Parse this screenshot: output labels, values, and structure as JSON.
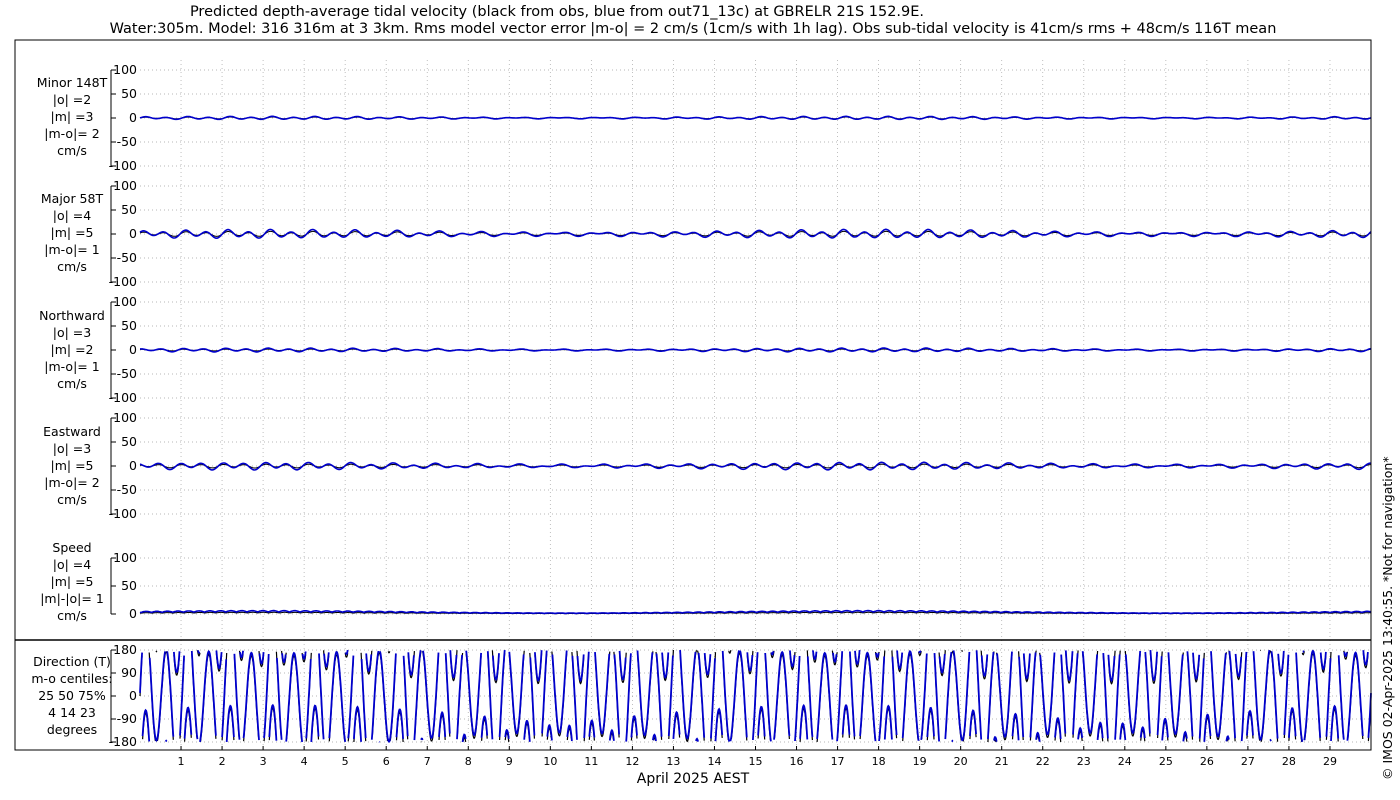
{
  "title_line1": "Predicted depth-average tidal velocity (black from obs, blue from out71_13c) at GBRELR 21S 152.9E.",
  "title_line2": "Water:305m. Model: 316 316m at 3 3km. Rms model vector error |m-o| = 2 cm/s (1cm/s with 1h lag). Obs sub-tidal velocity is 41cm/s rms + 48cm/s 116T mean",
  "credit": "© IMOS 02-Apr-2025 13:40:55. *Not for navigation*",
  "xlabel": "April 2025 AEST",
  "colors": {
    "obs": "#000000",
    "model": "#0000cc"
  },
  "chart_data": {
    "type": "line",
    "x_axis": {
      "label": "April 2025 AEST",
      "ticks": [
        1,
        2,
        3,
        4,
        5,
        6,
        7,
        8,
        9,
        10,
        11,
        12,
        13,
        14,
        15,
        16,
        17,
        18,
        19,
        20,
        21,
        22,
        23,
        24,
        25,
        26,
        27,
        28,
        29
      ],
      "range_days": [
        0,
        30.0
      ]
    },
    "panels": [
      {
        "id": "minor",
        "label_lines": [
          "Minor 148T",
          "|o| =2",
          "|m| =3",
          "|m-o|= 2",
          "cm/s"
        ],
        "yticks": [
          100,
          50,
          0,
          -50,
          -100
        ],
        "ylim": [
          -100,
          100
        ],
        "amplitude": [
          1.5,
          2.5
        ]
      },
      {
        "id": "major",
        "label_lines": [
          "Major 58T",
          "|o| =4",
          "|m| =5",
          "|m-o|= 1",
          "cm/s"
        ],
        "yticks": [
          100,
          50,
          0,
          -50,
          -100
        ],
        "ylim": [
          -100,
          100
        ],
        "amplitude": [
          4,
          7
        ]
      },
      {
        "id": "north",
        "label_lines": [
          "Northward",
          "|o| =3",
          "|m| =2",
          "|m-o|= 1",
          "cm/s"
        ],
        "yticks": [
          100,
          50,
          0,
          -50,
          -100
        ],
        "ylim": [
          -100,
          100
        ],
        "amplitude": [
          1.5,
          3
        ]
      },
      {
        "id": "east",
        "label_lines": [
          "Eastward",
          "|o| =3",
          "|m| =5",
          "|m-o|= 2",
          "cm/s"
        ],
        "yticks": [
          100,
          50,
          0,
          -50,
          -100
        ],
        "ylim": [
          -100,
          100
        ],
        "amplitude": [
          3,
          6
        ]
      },
      {
        "id": "speed",
        "label_lines": [
          "Speed",
          "|o| =4",
          "|m| =5",
          "|m|-|o|= 1",
          "cm/s"
        ],
        "yticks": [
          100,
          50,
          0
        ],
        "ylim": [
          -5,
          100
        ],
        "amplitude": [
          3,
          6
        ]
      },
      {
        "id": "direction",
        "label_lines": [
          "Direction (T)",
          "m-o centiles:",
          "25  50  75%",
          "4  14  23",
          "degrees"
        ],
        "yticks": [
          180,
          90,
          0,
          -90,
          -180
        ],
        "ylim": [
          -180,
          180
        ]
      }
    ]
  }
}
